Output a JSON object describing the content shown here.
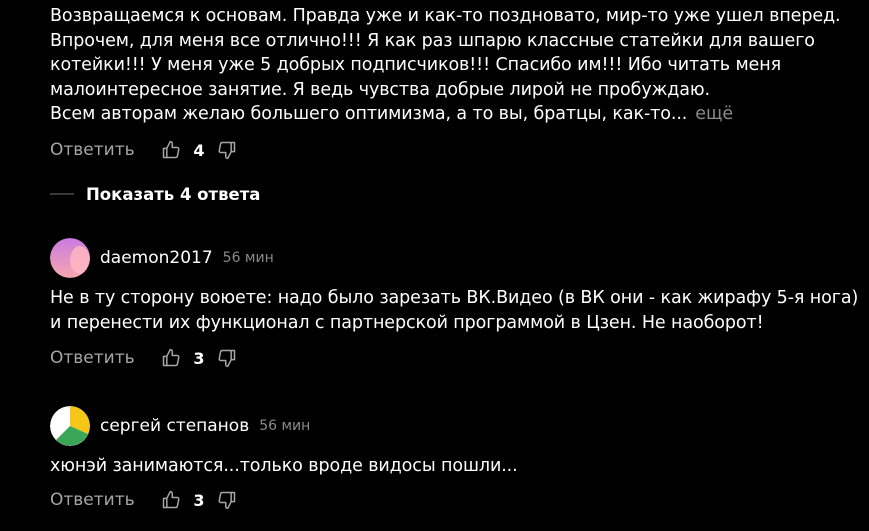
{
  "comments": [
    {
      "text": "Возвращаемся к основам. Правда уже и как-то поздновато, мир-то уже ушел вперед.\nВпрочем, для меня все отлично!!! Я как раз шпарю классные статейки для вашего\nкотейки!!! У меня уже 5 добрых подписчиков!!! Спасибо им!!! Ибо читать меня\nмалоинтересное занятие. Я ведь чувства добрые лирой не пробуждаю.\nВсем авторам желаю большего оптимизма, а то вы, братцы, как-то...",
      "more_label": "ещё",
      "reply_label": "Ответить",
      "likes": "4"
    },
    {
      "author": "daemon2017",
      "time": "56 мин",
      "text": "Не в ту сторону воюете: надо было зарезать ВК.Видео (в ВК они - как жирафу 5-я нога)\nи перенести их функционал с партнерской программой в Цзен. Не наоборот!",
      "reply_label": "Ответить",
      "likes": "3"
    },
    {
      "author": "сергей степанов",
      "time": "56 мин",
      "text": "хюнэй занимаются...только вроде видосы пошли...",
      "reply_label": "Ответить",
      "likes": "3"
    }
  ],
  "show_replies_label": "Показать 4 ответа",
  "colors": {
    "background": "#000000",
    "text": "#ffffff",
    "muted": "#a6a6a6",
    "avatar1_top": "#c97be0",
    "avatar1_bottom": "#f7a7b0",
    "avatar2_yellow": "#f5c518",
    "avatar2_green": "#3aa757",
    "avatar2_white": "#ffffff"
  }
}
